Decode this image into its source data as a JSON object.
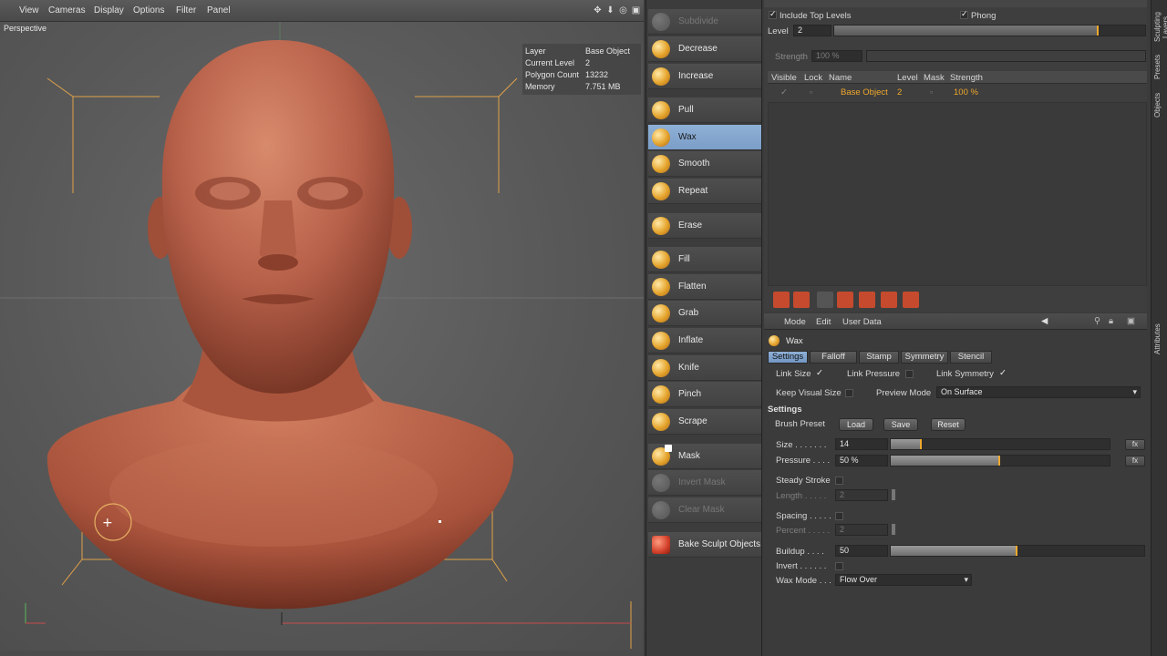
{
  "viewport": {
    "menu": [
      "View",
      "Cameras",
      "Display",
      "Options",
      "Filter",
      "Panel"
    ],
    "title": "Perspective",
    "info": [
      {
        "key": "Layer",
        "value": "Base Object"
      },
      {
        "key": "Current Level",
        "value": "2"
      },
      {
        "key": "Polygon Count",
        "value": "13232"
      },
      {
        "key": "Memory",
        "value": "7.751 MB"
      }
    ]
  },
  "tools": [
    {
      "label": "Subdivide",
      "state": "disabled"
    },
    {
      "label": "Decrease",
      "state": "normal"
    },
    {
      "label": "Increase",
      "state": "normal"
    },
    {
      "label": "Pull",
      "state": "normal"
    },
    {
      "label": "Wax",
      "state": "active"
    },
    {
      "label": "Smooth",
      "state": "normal"
    },
    {
      "label": "Repeat",
      "state": "normal"
    },
    {
      "label": "Erase",
      "state": "normal"
    },
    {
      "label": "Fill",
      "state": "normal"
    },
    {
      "label": "Flatten",
      "state": "normal"
    },
    {
      "label": "Grab",
      "state": "normal"
    },
    {
      "label": "Inflate",
      "state": "normal"
    },
    {
      "label": "Knife",
      "state": "normal"
    },
    {
      "label": "Pinch",
      "state": "normal"
    },
    {
      "label": "Scrape",
      "state": "normal"
    },
    {
      "label": "Mask",
      "state": "normal"
    },
    {
      "label": "Invert Mask",
      "state": "disabled"
    },
    {
      "label": "Clear Mask",
      "state": "disabled"
    },
    {
      "label": "Bake Sculpt Objects",
      "state": "normal"
    }
  ],
  "layers": {
    "include_top_levels": "Include Top Levels",
    "phong": "Phong",
    "level_label": "Level",
    "level_value": "2",
    "strength_label": "Strength",
    "strength_value": "100 %",
    "columns": [
      "Visible",
      "Lock",
      "Name",
      "Level",
      "Mask",
      "Strength"
    ],
    "row": {
      "name": "Base Object",
      "level": "2",
      "strength": "100 %"
    },
    "level_fraction": 0.85
  },
  "attributes": {
    "menu": [
      "Mode",
      "Edit",
      "User Data"
    ],
    "tool_name": "Wax",
    "tabs": [
      "Settings",
      "Falloff",
      "Stamp",
      "Symmetry",
      "Stencil"
    ],
    "link_size": "Link Size",
    "link_pressure": "Link Pressure",
    "link_symmetry": "Link Symmetry",
    "keep_visual_size": "Keep Visual Size",
    "preview_mode_label": "Preview Mode",
    "preview_mode_value": "On Surface",
    "settings_header": "Settings",
    "brush_preset": "Brush Preset",
    "load": "Load",
    "save": "Save",
    "reset": "Reset",
    "size_label": "Size . . . . . . .",
    "size_value": "14",
    "size_fraction": 0.14,
    "pressure_label": "Pressure . . . .",
    "pressure_value": "50 %",
    "pressure_fraction": 0.5,
    "fx": "fx",
    "steady_stroke": "Steady Stroke",
    "length_label": "Length . . . . .",
    "length_value": "2",
    "spacing_label": "Spacing . . . . .",
    "percent_label": "Percent . . . . .",
    "percent_value": "2",
    "buildup_label": "Buildup . . . .",
    "buildup_value": "50",
    "buildup_fraction": 0.5,
    "invert_label": "Invert . . . . . .",
    "wax_mode_label": "Wax Mode . . .",
    "wax_mode_value": "Flow Over"
  },
  "sidetabs": [
    "Sculpting Layers",
    "Presets",
    "Objects",
    "Attributes"
  ],
  "colors": {
    "accent": "#f0a82c",
    "selection": "#7b9ec8",
    "skin": "#b8614a"
  }
}
